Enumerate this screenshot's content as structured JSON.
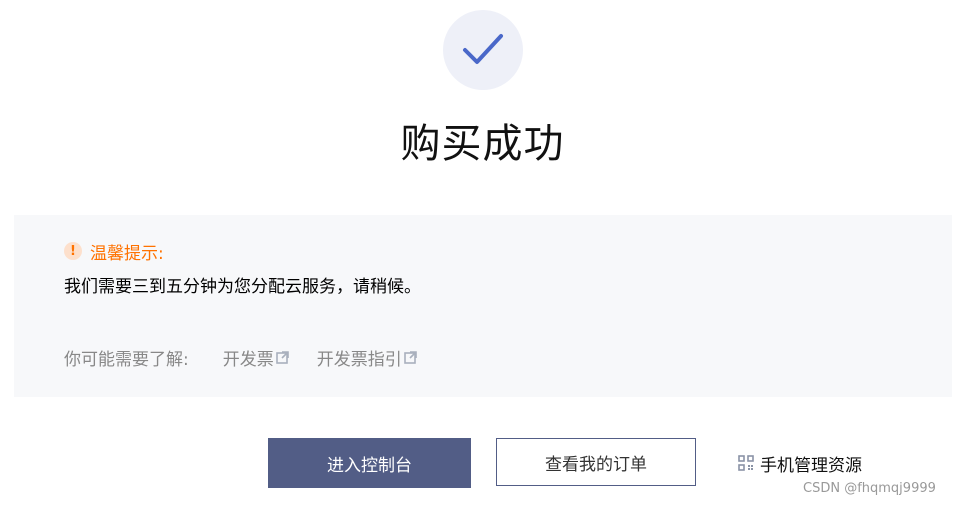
{
  "result": {
    "icon": "check-icon",
    "title": "购买成功"
  },
  "notice": {
    "icon": "exclamation-icon",
    "heading": "温馨提示:",
    "message": "我们需要三到五分钟为您分配云服务，请稍候。",
    "links_label": "你可能需要了解:",
    "links": [
      {
        "label": "开发票",
        "icon": "external-link-icon"
      },
      {
        "label": "开发票指引",
        "icon": "external-link-icon"
      }
    ]
  },
  "actions": {
    "primary_label": "进入控制台",
    "secondary_label": "查看我的订单",
    "mobile_label": "手机管理资源",
    "mobile_icon": "qr-code-icon"
  },
  "watermark": "CSDN @fhqmqj9999",
  "colors": {
    "accent": "#525d86",
    "check": "#4a68c9",
    "check_bg": "#eef0f8",
    "warning": "#ff7200",
    "panel_bg": "#f7f8fa",
    "muted": "#888888"
  }
}
